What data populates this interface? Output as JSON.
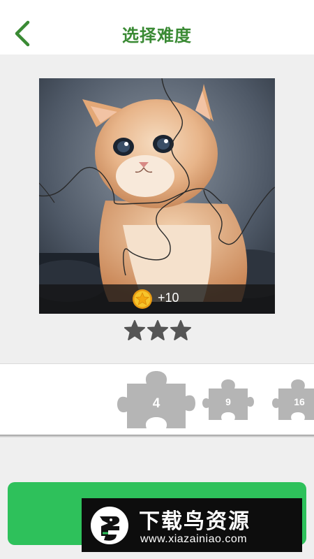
{
  "header": {
    "title": "选择难度",
    "back_icon": "chevron-left-icon"
  },
  "preview": {
    "image": "kitten-puzzle-photo",
    "reward_icon": "gold-coin-star-icon",
    "reward_text": "+10"
  },
  "rating": {
    "stars_filled": 3,
    "stars_total": 3,
    "star_icon": "star-icon"
  },
  "difficulty": {
    "options": [
      {
        "label": "4"
      },
      {
        "label": "9"
      },
      {
        "label": "16"
      }
    ]
  },
  "watermark": {
    "title": "下载鸟资源",
    "url": "www.xiazainiao.com"
  },
  "colors": {
    "accent_green": "#3a8a34",
    "button_green": "#2ec15b",
    "piece_gray": "#b5b5b5",
    "star_gray": "#555555",
    "coin_gold": "#f4b81c"
  }
}
